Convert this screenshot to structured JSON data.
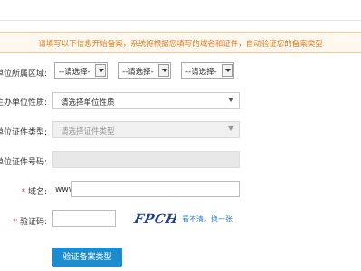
{
  "notice": "请填写以下信息开始备案，系统将根据您填写的域名和证件，自动验证您的备案类型",
  "form": {
    "region_label": "单位所属区域:",
    "region_selects": [
      "--请选择-",
      "--请选择-",
      "--请选择-"
    ],
    "org_nature_label": "主办单位性质:",
    "org_nature_value": "请选择单位性质",
    "cert_type_label": "单位证件类型:",
    "cert_type_value": "请选择证件类型",
    "cert_number_label": "单位证件号码:",
    "domain_label": "域名:",
    "domain_prefix": "www.",
    "domain_value": "",
    "captcha_label": "验证码:",
    "captcha_value": "",
    "captcha_image_text": "FPCH",
    "refresh_link": "看不清，换一张",
    "submit_label": "验证备案类型"
  },
  "colors": {
    "notice_text": "#e07b1f",
    "notice_bg": "#fff8ef",
    "required_mark": "#e0453c",
    "link": "#2a7fd4",
    "button_bg": "#1a8ccf"
  }
}
